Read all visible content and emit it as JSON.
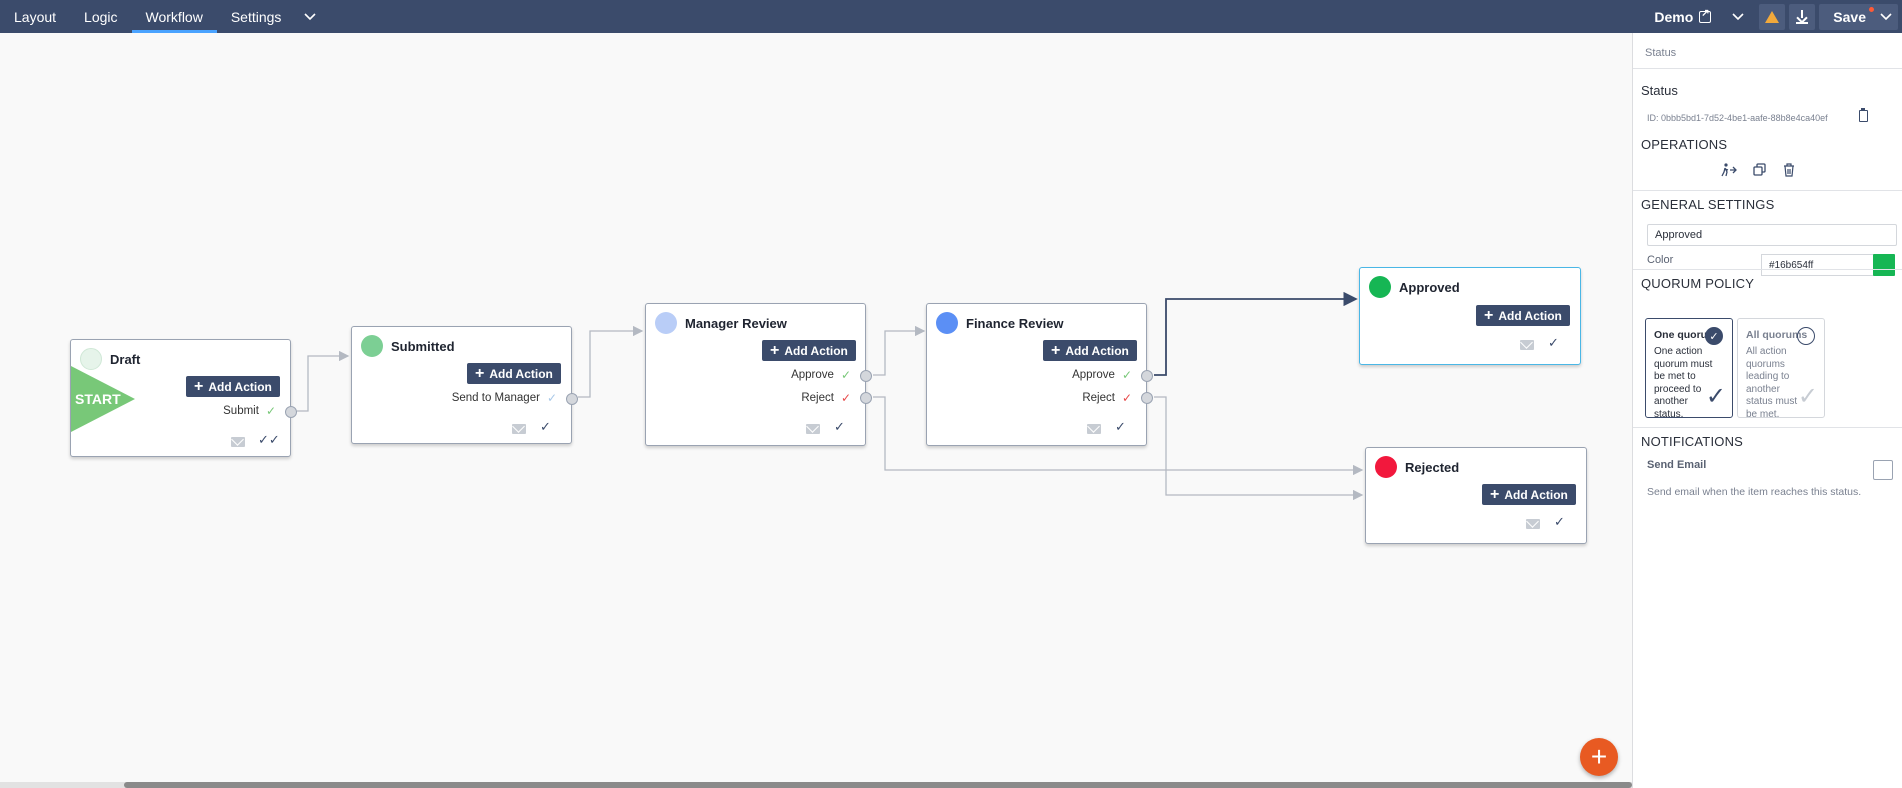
{
  "tabs": [
    {
      "label": "Layout",
      "active": false
    },
    {
      "label": "Logic",
      "active": false
    },
    {
      "label": "Workflow",
      "active": true
    },
    {
      "label": "Settings",
      "active": false
    }
  ],
  "header": {
    "demo_label": "Demo",
    "save_label": "Save"
  },
  "colors": {
    "topbar": "#3b4b6b",
    "accent": "#4aa3ff",
    "warning": "#f2a93b",
    "fab": "#e85a22"
  },
  "workflow": {
    "start_label": "START",
    "add_action_label": "Add Action",
    "nodes": {
      "draft": {
        "title": "Draft",
        "color": "#e6f4ea",
        "actions": [
          {
            "label": "Submit",
            "check": "✓",
            "check_color": "#78c878"
          }
        ],
        "footer_check": "✓✓"
      },
      "submitted": {
        "title": "Submitted",
        "color": "#7ccf94",
        "actions": [
          {
            "label": "Send to Manager",
            "check": "✓",
            "check_color": "#a8c8e8"
          }
        ],
        "footer_check": "✓"
      },
      "manager": {
        "title": "Manager Review",
        "color": "#b9cdf7",
        "actions": [
          {
            "label": "Approve",
            "check": "✓",
            "check_color": "#78c878"
          },
          {
            "label": "Reject",
            "check": "✓",
            "check_color": "#e84a4a"
          }
        ],
        "footer_check": "✓"
      },
      "finance": {
        "title": "Finance Review",
        "color": "#5b8ff5",
        "actions": [
          {
            "label": "Approve",
            "check": "✓",
            "check_color": "#78c878"
          },
          {
            "label": "Reject",
            "check": "✓",
            "check_color": "#e84a4a"
          }
        ],
        "footer_check": "✓"
      },
      "approved": {
        "title": "Approved",
        "color": "#16b654",
        "footer_check": "✓"
      },
      "rejected": {
        "title": "Rejected",
        "color": "#f2183d",
        "footer_check": "✓"
      }
    }
  },
  "panel": {
    "breadcrumb": "Status",
    "title": "Status",
    "id_text": "ID: 0bbb5bd1-7d52-4be1-aafe-88b8e4ca40ef",
    "operations_heading": "OPERATIONS",
    "operations": [
      "transition-icon",
      "copy-icon",
      "trash-icon"
    ],
    "general_heading": "GENERAL SETTINGS",
    "name_value": "Approved",
    "color_label": "Color",
    "color_value": "#16b654ff",
    "color_hex": "#16b654",
    "quorum_heading": "QUORUM POLICY",
    "quorum_options": [
      {
        "title": "One quorum",
        "desc": "One action quorum must be met to proceed to another status.",
        "selected": true
      },
      {
        "title": "All quorums",
        "desc": "All action quorums leading to another status must be met.",
        "selected": false
      }
    ],
    "notifications_heading": "NOTIFICATIONS",
    "send_email_label": "Send Email",
    "send_email_desc": "Send email when the item reaches this status.",
    "send_email_checked": false
  }
}
